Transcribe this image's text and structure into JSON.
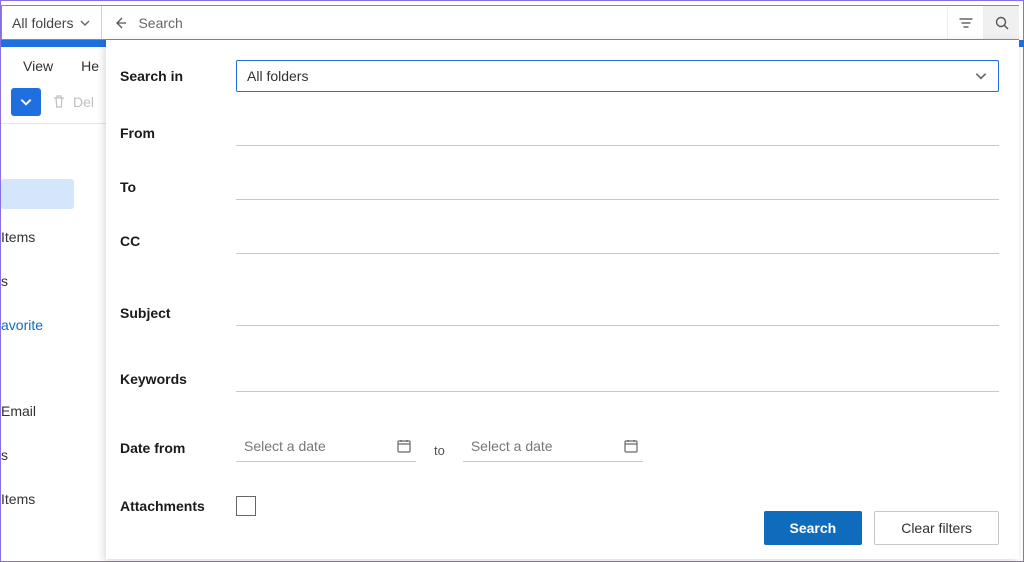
{
  "searchbar": {
    "scope_label": "All folders",
    "placeholder": "Search"
  },
  "tabs": {
    "view": "View",
    "help_fragment": "He"
  },
  "toolbar": {
    "delete_fragment": "Del"
  },
  "sidebar": {
    "items": [
      "Items",
      "s",
      "avorite",
      "Email",
      "s",
      "Items"
    ]
  },
  "panel": {
    "labels": {
      "search_in": "Search in",
      "from": "From",
      "to": "To",
      "cc": "CC",
      "subject": "Subject",
      "keywords": "Keywords",
      "date_from": "Date from",
      "date_to_sep": "to",
      "attachments": "Attachments"
    },
    "search_in_value": "All folders",
    "date_placeholder": "Select a date",
    "buttons": {
      "search": "Search",
      "clear": "Clear filters"
    }
  }
}
